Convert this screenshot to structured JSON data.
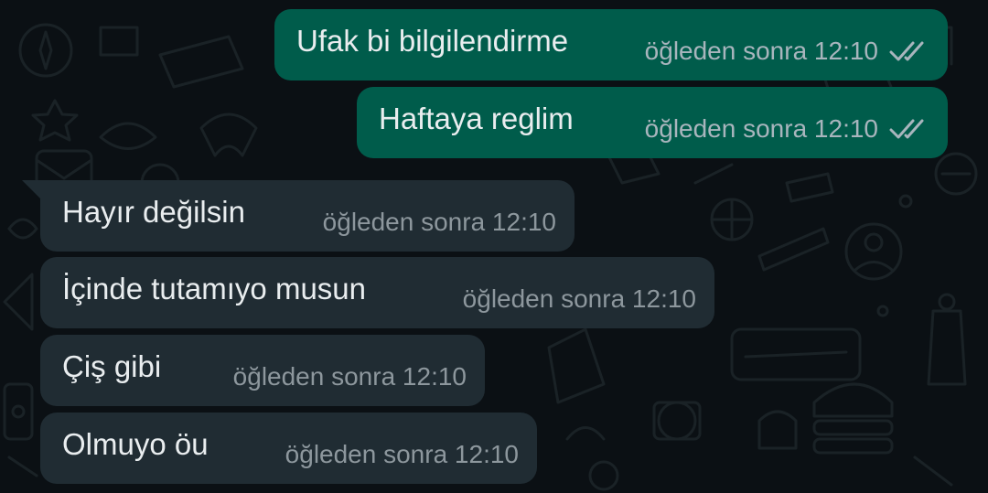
{
  "chat": {
    "messages": [
      {
        "direction": "out",
        "text": "Ufak bi bilgilendirme",
        "time": "öğleden sonra 12:10",
        "status_icon": "double-check-icon"
      },
      {
        "direction": "out",
        "text": "Haftaya reglim",
        "time": "öğleden sonra 12:10",
        "status_icon": "double-check-icon"
      },
      {
        "direction": "in",
        "text": "Hayır değilsin",
        "time": "öğleden sonra 12:10"
      },
      {
        "direction": "in",
        "text": "İçinde tutamıyo musun",
        "time": "öğleden sonra 12:10"
      },
      {
        "direction": "in",
        "text": "Çiş gibi",
        "time": "öğleden sonra 12:10"
      },
      {
        "direction": "in",
        "text": "Olmuyo öu",
        "time": "öğleden sonra 12:10"
      }
    ]
  },
  "colors": {
    "background": "#0b1014",
    "outgoing_bubble": "#005c4b",
    "incoming_bubble": "#202c33",
    "message_text": "#e9edef",
    "timestamp_text": "#8d979d",
    "read_ticks": "#a8b5bd"
  }
}
